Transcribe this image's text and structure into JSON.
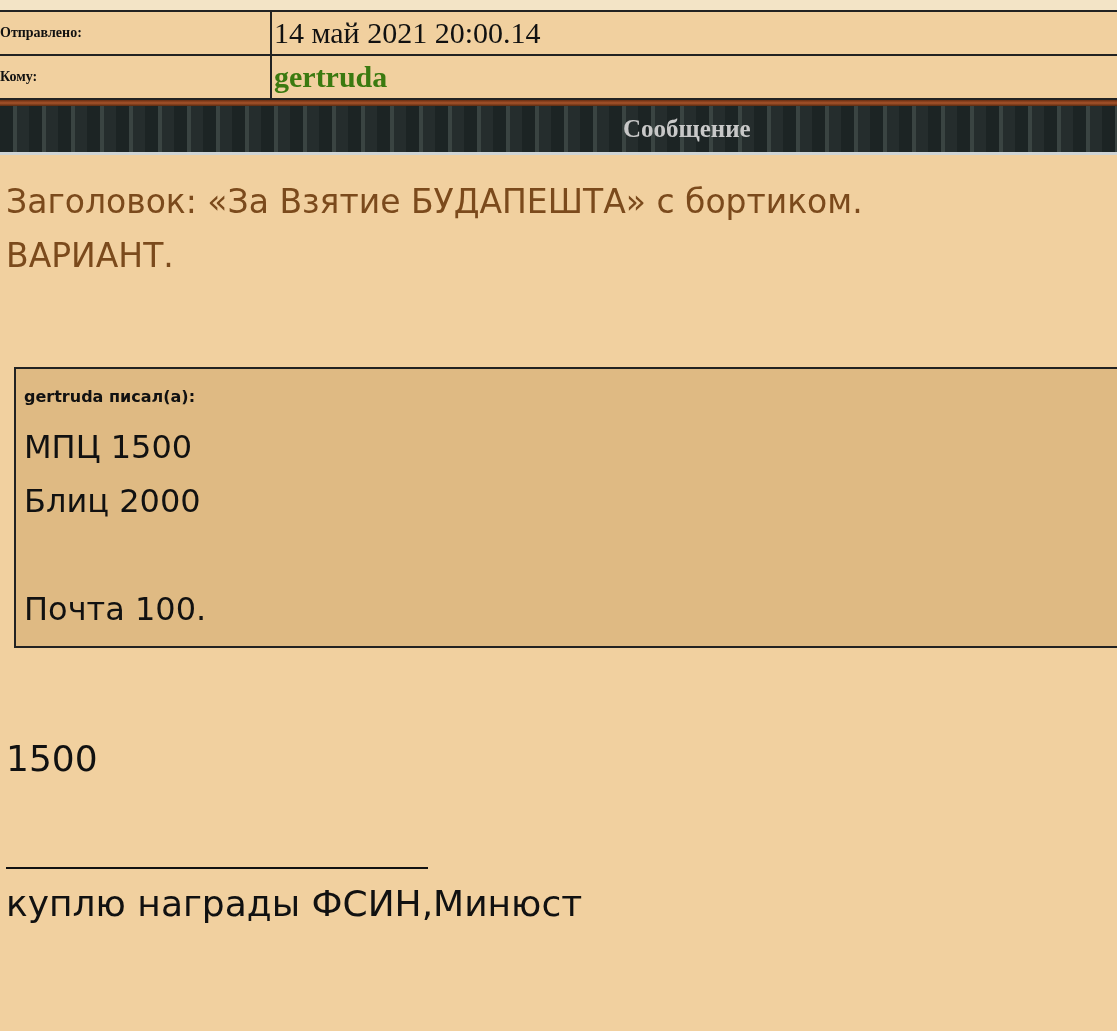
{
  "header_rows": [
    {
      "label": "Отправлено:",
      "value": "14 май 2021 20:00.14",
      "kind": "date"
    },
    {
      "label": "Кому:",
      "value": "gertruda",
      "kind": "user"
    }
  ],
  "section_bar": {
    "title": "Сообщение"
  },
  "message": {
    "subject": "Заголовок: «За Взятие БУДАПЕШТА» с бортиком.\nВАРИАНТ.",
    "quote": {
      "author_line": "gertruda писал(а):",
      "paragraphs": [
        [
          "МПЦ 1500",
          "Блиц 2000"
        ],
        [
          "Почта 100."
        ]
      ]
    },
    "body": "1500",
    "signature": "куплю награды ФСИН,Минюст"
  }
}
